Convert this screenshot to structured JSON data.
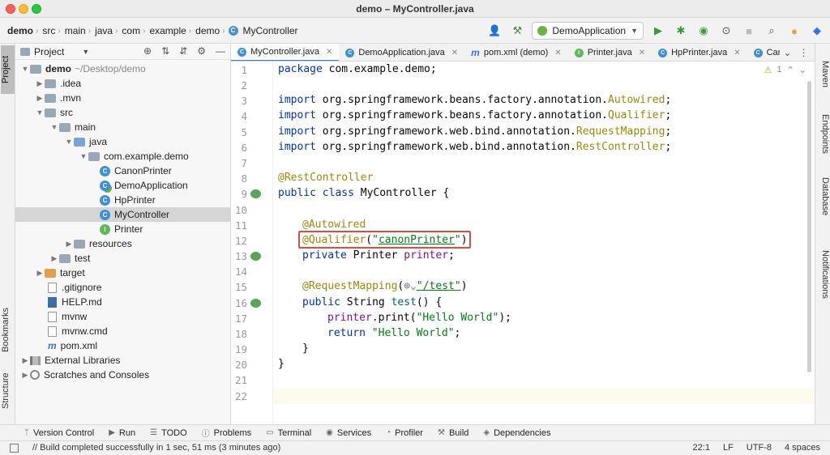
{
  "window": {
    "title": "demo – MyController.java"
  },
  "breadcrumbs": [
    "demo",
    "src",
    "main",
    "java",
    "com",
    "example",
    "demo",
    "MyController"
  ],
  "run_config": {
    "label": "DemoApplication"
  },
  "project_panel": {
    "title": "Project",
    "tree": [
      {
        "label": "demo",
        "hint": "~/Desktop/demo"
      },
      {
        "label": ".idea"
      },
      {
        "label": ".mvn"
      },
      {
        "label": "src"
      },
      {
        "label": "main"
      },
      {
        "label": "java"
      },
      {
        "label": "com.example.demo"
      },
      {
        "label": "CanonPrinter"
      },
      {
        "label": "DemoApplication"
      },
      {
        "label": "HpPrinter"
      },
      {
        "label": "MyController"
      },
      {
        "label": "Printer"
      },
      {
        "label": "resources"
      },
      {
        "label": "test"
      },
      {
        "label": "target"
      },
      {
        "label": ".gitignore"
      },
      {
        "label": "HELP.md"
      },
      {
        "label": "mvnw"
      },
      {
        "label": "mvnw.cmd"
      },
      {
        "label": "pom.xml"
      },
      {
        "label": "External Libraries"
      },
      {
        "label": "Scratches and Consoles"
      }
    ]
  },
  "left_strip": {
    "project": "Project",
    "bookmarks": "Bookmarks",
    "structure": "Structure"
  },
  "right_strip": {
    "maven": "Maven",
    "endpoints": "Endpoints",
    "database": "Database",
    "notifications": "Notifications"
  },
  "tabs": [
    {
      "label": "MyController.java"
    },
    {
      "label": "DemoApplication.java"
    },
    {
      "label": "pom.xml (demo)"
    },
    {
      "label": "Printer.java"
    },
    {
      "label": "HpPrinter.java"
    },
    {
      "label": "CanonPrin"
    }
  ],
  "editor": {
    "warning_count": "1",
    "line_numbers": [
      "1",
      "2",
      "3",
      "4",
      "5",
      "6",
      "7",
      "8",
      "9",
      "10",
      "11",
      "12",
      "13",
      "14",
      "15",
      "16",
      "17",
      "18",
      "19",
      "20",
      "21",
      "22"
    ],
    "code": {
      "l1_kw": "package",
      "l1_rest": " com.example.demo;",
      "imp_kw": "import",
      "l3_pkg": " org.springframework.beans.factory.annotation.",
      "l3_cls": "Autowired",
      "l4_pkg": " org.springframework.beans.factory.annotation.",
      "l4_cls": "Qualifier",
      "l5_pkg": " org.springframework.web.bind.annotation.",
      "l5_cls": "RequestMapping",
      "l6_pkg": " org.springframework.web.bind.annotation.",
      "l6_cls": "RestController",
      "semi": ";",
      "l8": "@RestController",
      "l9_kw": "public class",
      "l9_rest": " MyController {",
      "l11": "@Autowired",
      "l12_ann": "@Qualifier",
      "l12_open": "(",
      "l12_str_q": "\"",
      "l12_str": "canonPrinter",
      "l12_close": ")",
      "l13_kw": "private",
      "l13_type": " Printer ",
      "l13_fld": "printer",
      "l15_ann": "@RequestMapping",
      "l15_open": "(",
      "l15_str": "\"/test\"",
      "l15_close": ")",
      "l16_kw": "public",
      "l16_type": " String ",
      "l16_meth": "test",
      "l16_rest": "() {",
      "l17_fld": "printer",
      "l17_call": ".print(",
      "l17_str": "\"Hello World\"",
      "l17_end": ");",
      "l18_kw": "return",
      "l18_str": " \"Hello World\"",
      "l18_end": ";",
      "l19": "}",
      "l20": "}"
    }
  },
  "bottom_tools": [
    "Version Control",
    "Run",
    "TODO",
    "Problems",
    "Terminal",
    "Services",
    "Profiler",
    "Build",
    "Dependencies"
  ],
  "status": {
    "message": "// Build completed successfully in 1 sec, 51 ms (3 minutes ago)",
    "position": "22:1",
    "line_sep": "LF",
    "encoding": "UTF-8",
    "indent": "4 spaces"
  },
  "colors": {
    "accent": "#3574f0",
    "highlight_box": "#e04a3f",
    "keyword": "#0033b3",
    "annotation": "#9e880d",
    "string": "#067d17"
  }
}
